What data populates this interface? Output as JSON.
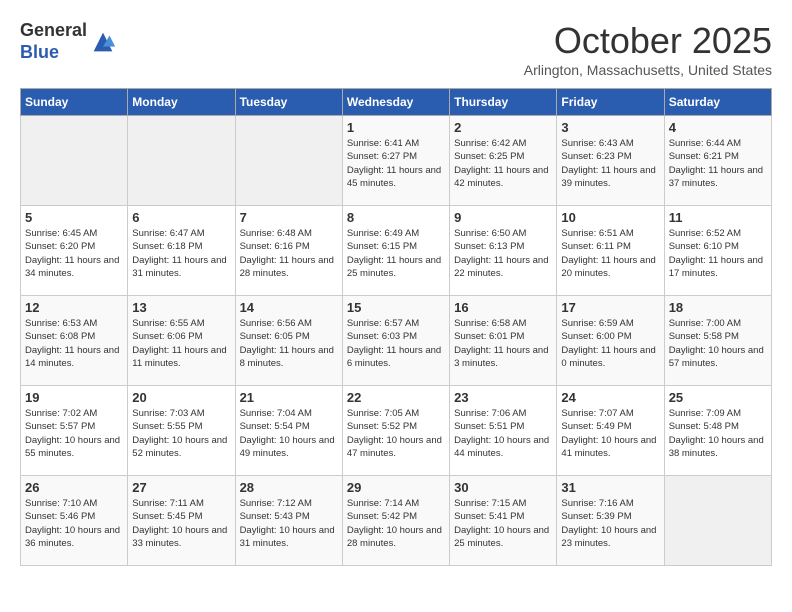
{
  "header": {
    "logo_line1": "General",
    "logo_line2": "Blue",
    "month_title": "October 2025",
    "subtitle": "Arlington, Massachusetts, United States"
  },
  "days_of_week": [
    "Sunday",
    "Monday",
    "Tuesday",
    "Wednesday",
    "Thursday",
    "Friday",
    "Saturday"
  ],
  "weeks": [
    [
      {
        "day": "",
        "sunrise": "",
        "sunset": "",
        "daylight": "",
        "empty": true
      },
      {
        "day": "",
        "sunrise": "",
        "sunset": "",
        "daylight": "",
        "empty": true
      },
      {
        "day": "",
        "sunrise": "",
        "sunset": "",
        "daylight": "",
        "empty": true
      },
      {
        "day": "1",
        "sunrise": "Sunrise: 6:41 AM",
        "sunset": "Sunset: 6:27 PM",
        "daylight": "Daylight: 11 hours and 45 minutes."
      },
      {
        "day": "2",
        "sunrise": "Sunrise: 6:42 AM",
        "sunset": "Sunset: 6:25 PM",
        "daylight": "Daylight: 11 hours and 42 minutes."
      },
      {
        "day": "3",
        "sunrise": "Sunrise: 6:43 AM",
        "sunset": "Sunset: 6:23 PM",
        "daylight": "Daylight: 11 hours and 39 minutes."
      },
      {
        "day": "4",
        "sunrise": "Sunrise: 6:44 AM",
        "sunset": "Sunset: 6:21 PM",
        "daylight": "Daylight: 11 hours and 37 minutes."
      }
    ],
    [
      {
        "day": "5",
        "sunrise": "Sunrise: 6:45 AM",
        "sunset": "Sunset: 6:20 PM",
        "daylight": "Daylight: 11 hours and 34 minutes."
      },
      {
        "day": "6",
        "sunrise": "Sunrise: 6:47 AM",
        "sunset": "Sunset: 6:18 PM",
        "daylight": "Daylight: 11 hours and 31 minutes."
      },
      {
        "day": "7",
        "sunrise": "Sunrise: 6:48 AM",
        "sunset": "Sunset: 6:16 PM",
        "daylight": "Daylight: 11 hours and 28 minutes."
      },
      {
        "day": "8",
        "sunrise": "Sunrise: 6:49 AM",
        "sunset": "Sunset: 6:15 PM",
        "daylight": "Daylight: 11 hours and 25 minutes."
      },
      {
        "day": "9",
        "sunrise": "Sunrise: 6:50 AM",
        "sunset": "Sunset: 6:13 PM",
        "daylight": "Daylight: 11 hours and 22 minutes."
      },
      {
        "day": "10",
        "sunrise": "Sunrise: 6:51 AM",
        "sunset": "Sunset: 6:11 PM",
        "daylight": "Daylight: 11 hours and 20 minutes."
      },
      {
        "day": "11",
        "sunrise": "Sunrise: 6:52 AM",
        "sunset": "Sunset: 6:10 PM",
        "daylight": "Daylight: 11 hours and 17 minutes."
      }
    ],
    [
      {
        "day": "12",
        "sunrise": "Sunrise: 6:53 AM",
        "sunset": "Sunset: 6:08 PM",
        "daylight": "Daylight: 11 hours and 14 minutes."
      },
      {
        "day": "13",
        "sunrise": "Sunrise: 6:55 AM",
        "sunset": "Sunset: 6:06 PM",
        "daylight": "Daylight: 11 hours and 11 minutes."
      },
      {
        "day": "14",
        "sunrise": "Sunrise: 6:56 AM",
        "sunset": "Sunset: 6:05 PM",
        "daylight": "Daylight: 11 hours and 8 minutes."
      },
      {
        "day": "15",
        "sunrise": "Sunrise: 6:57 AM",
        "sunset": "Sunset: 6:03 PM",
        "daylight": "Daylight: 11 hours and 6 minutes."
      },
      {
        "day": "16",
        "sunrise": "Sunrise: 6:58 AM",
        "sunset": "Sunset: 6:01 PM",
        "daylight": "Daylight: 11 hours and 3 minutes."
      },
      {
        "day": "17",
        "sunrise": "Sunrise: 6:59 AM",
        "sunset": "Sunset: 6:00 PM",
        "daylight": "Daylight: 11 hours and 0 minutes."
      },
      {
        "day": "18",
        "sunrise": "Sunrise: 7:00 AM",
        "sunset": "Sunset: 5:58 PM",
        "daylight": "Daylight: 10 hours and 57 minutes."
      }
    ],
    [
      {
        "day": "19",
        "sunrise": "Sunrise: 7:02 AM",
        "sunset": "Sunset: 5:57 PM",
        "daylight": "Daylight: 10 hours and 55 minutes."
      },
      {
        "day": "20",
        "sunrise": "Sunrise: 7:03 AM",
        "sunset": "Sunset: 5:55 PM",
        "daylight": "Daylight: 10 hours and 52 minutes."
      },
      {
        "day": "21",
        "sunrise": "Sunrise: 7:04 AM",
        "sunset": "Sunset: 5:54 PM",
        "daylight": "Daylight: 10 hours and 49 minutes."
      },
      {
        "day": "22",
        "sunrise": "Sunrise: 7:05 AM",
        "sunset": "Sunset: 5:52 PM",
        "daylight": "Daylight: 10 hours and 47 minutes."
      },
      {
        "day": "23",
        "sunrise": "Sunrise: 7:06 AM",
        "sunset": "Sunset: 5:51 PM",
        "daylight": "Daylight: 10 hours and 44 minutes."
      },
      {
        "day": "24",
        "sunrise": "Sunrise: 7:07 AM",
        "sunset": "Sunset: 5:49 PM",
        "daylight": "Daylight: 10 hours and 41 minutes."
      },
      {
        "day": "25",
        "sunrise": "Sunrise: 7:09 AM",
        "sunset": "Sunset: 5:48 PM",
        "daylight": "Daylight: 10 hours and 38 minutes."
      }
    ],
    [
      {
        "day": "26",
        "sunrise": "Sunrise: 7:10 AM",
        "sunset": "Sunset: 5:46 PM",
        "daylight": "Daylight: 10 hours and 36 minutes."
      },
      {
        "day": "27",
        "sunrise": "Sunrise: 7:11 AM",
        "sunset": "Sunset: 5:45 PM",
        "daylight": "Daylight: 10 hours and 33 minutes."
      },
      {
        "day": "28",
        "sunrise": "Sunrise: 7:12 AM",
        "sunset": "Sunset: 5:43 PM",
        "daylight": "Daylight: 10 hours and 31 minutes."
      },
      {
        "day": "29",
        "sunrise": "Sunrise: 7:14 AM",
        "sunset": "Sunset: 5:42 PM",
        "daylight": "Daylight: 10 hours and 28 minutes."
      },
      {
        "day": "30",
        "sunrise": "Sunrise: 7:15 AM",
        "sunset": "Sunset: 5:41 PM",
        "daylight": "Daylight: 10 hours and 25 minutes."
      },
      {
        "day": "31",
        "sunrise": "Sunrise: 7:16 AM",
        "sunset": "Sunset: 5:39 PM",
        "daylight": "Daylight: 10 hours and 23 minutes."
      },
      {
        "day": "",
        "sunrise": "",
        "sunset": "",
        "daylight": "",
        "empty": true
      }
    ]
  ]
}
